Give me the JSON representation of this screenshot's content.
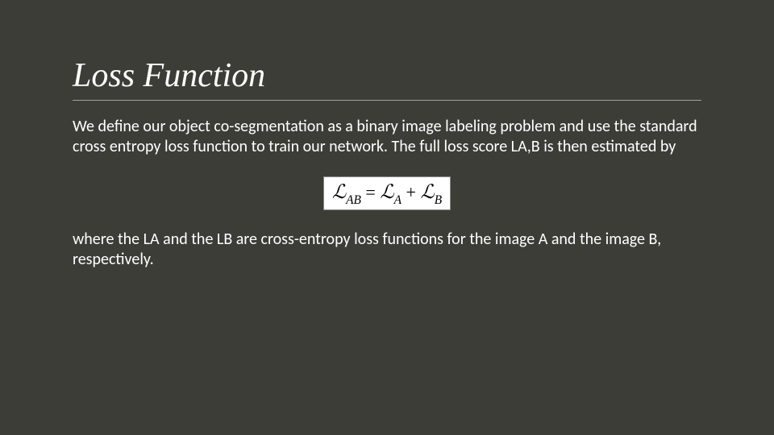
{
  "slide": {
    "title": "Loss Function",
    "paragraph1": "We define our object co-segmentation as a binary image labeling problem and use the standard cross entropy loss function to train our network. The full loss score LA,B is then estimated by",
    "equation_text": "ℒAB = ℒA + ℒB",
    "paragraph2": "where the LA and the LB are cross-entropy loss functions for the image A and the image B, respectively."
  }
}
